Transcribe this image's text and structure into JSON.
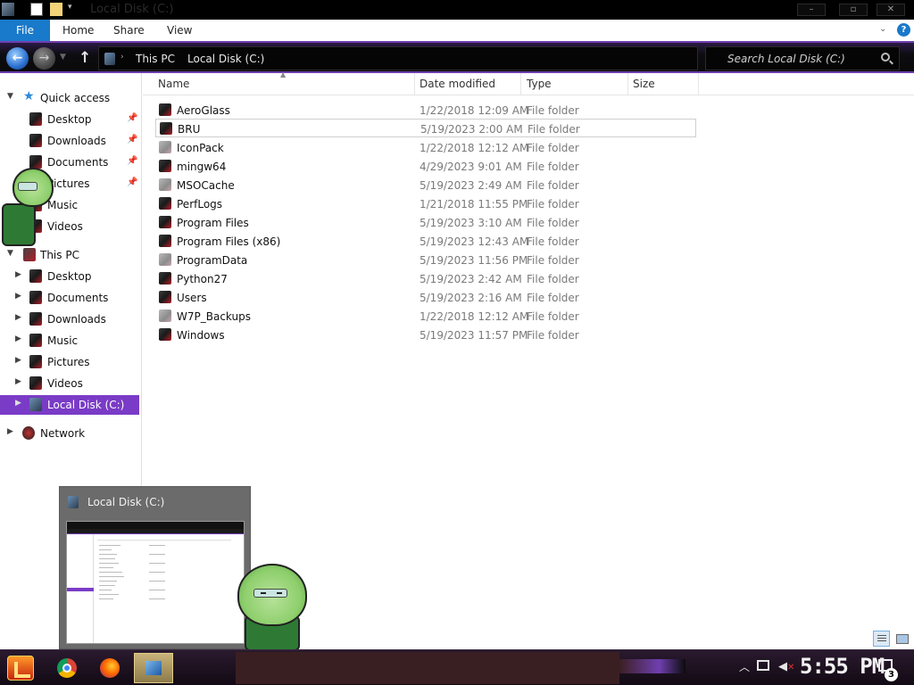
{
  "window": {
    "title": "Local Disk (C:)"
  },
  "ribbon": {
    "tabs": [
      "File",
      "Home",
      "Share",
      "View"
    ]
  },
  "address": {
    "crumbs": [
      "This PC",
      "Local Disk (C:)"
    ]
  },
  "search": {
    "placeholder": "Search Local Disk (C:)"
  },
  "sidebar": {
    "quick_access": {
      "label": "Quick access",
      "items": [
        "Desktop",
        "Downloads",
        "Documents",
        "Pictures",
        "Music",
        "Videos"
      ]
    },
    "this_pc": {
      "label": "This PC",
      "items": [
        "Desktop",
        "Documents",
        "Downloads",
        "Music",
        "Pictures",
        "Videos",
        "Local Disk (C:)"
      ]
    },
    "network": {
      "label": "Network"
    }
  },
  "columns": {
    "name": "Name",
    "date_modified": "Date modified",
    "type": "Type",
    "size": "Size"
  },
  "files": [
    {
      "name": "AeroGlass",
      "date": "1/22/2018 12:09 AM",
      "type": "File folder"
    },
    {
      "name": "BRU",
      "date": "5/19/2023 2:00 AM",
      "type": "File folder"
    },
    {
      "name": "IconPack",
      "date": "1/22/2018 12:12 AM",
      "type": "File folder"
    },
    {
      "name": "mingw64",
      "date": "4/29/2023 9:01 AM",
      "type": "File folder"
    },
    {
      "name": "MSOCache",
      "date": "5/19/2023 2:49 AM",
      "type": "File folder"
    },
    {
      "name": "PerfLogs",
      "date": "1/21/2018 11:55 PM",
      "type": "File folder"
    },
    {
      "name": "Program Files",
      "date": "5/19/2023 3:10 AM",
      "type": "File folder"
    },
    {
      "name": "Program Files (x86)",
      "date": "5/19/2023 12:43 AM",
      "type": "File folder"
    },
    {
      "name": "ProgramData",
      "date": "5/19/2023 11:56 PM",
      "type": "File folder"
    },
    {
      "name": "Python27",
      "date": "5/19/2023 2:42 AM",
      "type": "File folder"
    },
    {
      "name": "Users",
      "date": "5/19/2023 2:16 AM",
      "type": "File folder"
    },
    {
      "name": "W7P_Backups",
      "date": "1/22/2018 12:12 AM",
      "type": "File folder"
    },
    {
      "name": "Windows",
      "date": "5/19/2023 11:57 PM",
      "type": "File folder"
    }
  ],
  "taskbar_preview": {
    "title": "Local Disk (C:)"
  },
  "tray": {
    "clock": "5:55 PM",
    "notification_count": "3"
  },
  "colors": {
    "accent_purple": "#7a3bc6",
    "file_tab_blue": "#1979ca",
    "taskbar_bg": "#120a14"
  }
}
